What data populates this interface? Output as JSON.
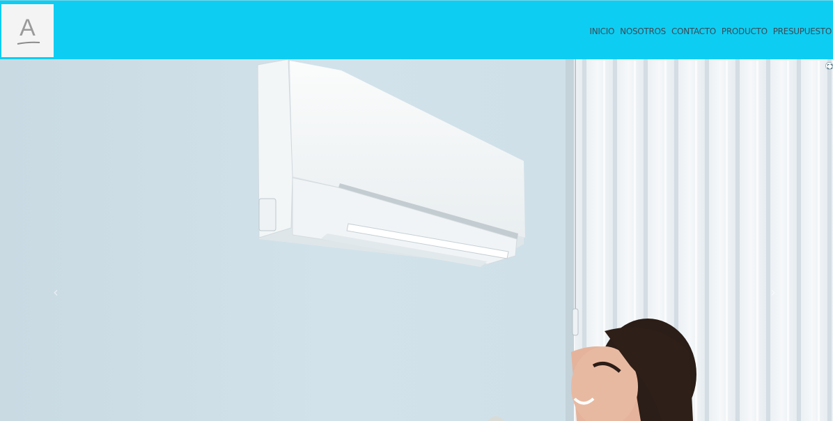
{
  "header": {
    "logo_letter": "A",
    "background": "#0ecdf2"
  },
  "nav": {
    "items": [
      {
        "label": "INICIO"
      },
      {
        "label": "NOSOTROS"
      },
      {
        "label": "CONTACTO"
      },
      {
        "label": "PRODUCTO"
      },
      {
        "label": "PRESUPUESTO"
      }
    ]
  },
  "slider": {
    "prev_glyph": "‹",
    "next_glyph": "›",
    "image_subject": "air-conditioner-and-woman-photo",
    "fullscreen_icon": "fullscreen-icon"
  }
}
